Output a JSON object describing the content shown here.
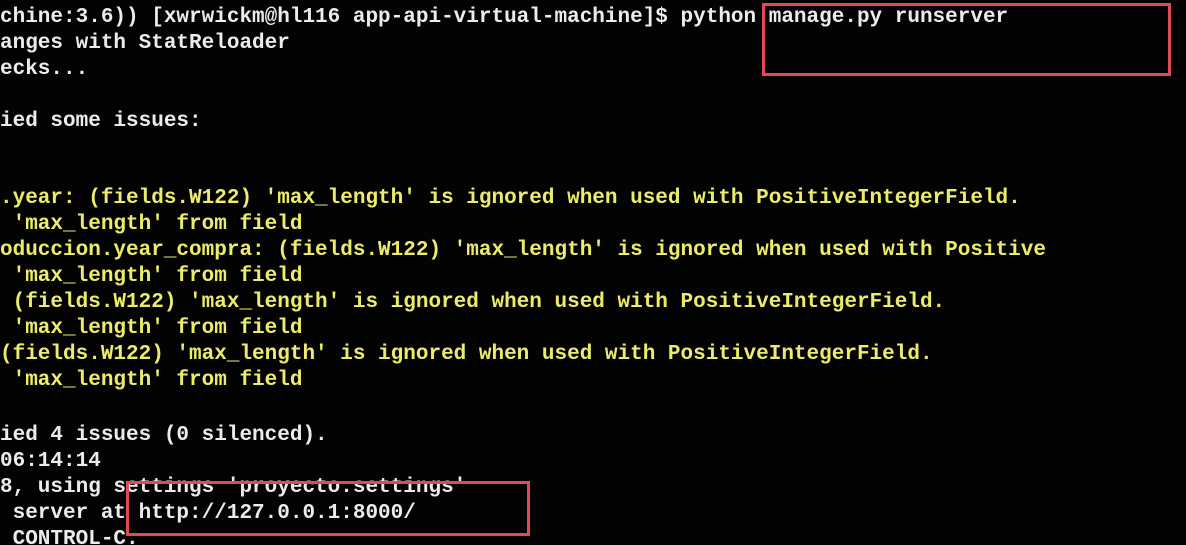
{
  "terminal": {
    "lines": [
      {
        "text": "chine:3.6)) [xwrwickm@hl116 app-api-virtual-machine]$ python manage.py runserver",
        "color": "#ececec"
      },
      {
        "text": "anges with StatReloader",
        "color": "#ececec"
      },
      {
        "text": "ecks...",
        "color": "#ececec"
      },
      {
        "text": "",
        "color": "#ececec"
      },
      {
        "text": "ied some issues:",
        "color": "#ececec"
      },
      {
        "text": "",
        "color": "#ececec"
      },
      {
        "text": "",
        "color": "#ececec"
      },
      {
        "text": ".year: (fields.W122) 'max_length' is ignored when used with PositiveIntegerField.",
        "color": "#ecec6a"
      },
      {
        "text": " 'max_length' from field",
        "color": "#ecec6a"
      },
      {
        "text": "oduccion.year_compra: (fields.W122) 'max_length' is ignored when used with Positive",
        "color": "#ecec6a"
      },
      {
        "text": " 'max_length' from field",
        "color": "#ecec6a"
      },
      {
        "text": " (fields.W122) 'max_length' is ignored when used with PositiveIntegerField.",
        "color": "#ecec6a"
      },
      {
        "text": " 'max_length' from field",
        "color": "#ecec6a"
      },
      {
        "text": "(fields.W122) 'max_length' is ignored when used with PositiveIntegerField.",
        "color": "#ecec6a"
      },
      {
        "text": " 'max_length' from field",
        "color": "#ecec6a"
      },
      {
        "text": "",
        "color": "#ececec"
      },
      {
        "text": "ied 4 issues (0 silenced).",
        "color": "#ececec"
      },
      {
        "text": "06:14:14",
        "color": "#ececec"
      },
      {
        "text": "8, using settings 'proyecto.settings'",
        "color": "#ececec"
      },
      {
        "text": " server at http://127.0.0.1:8000/",
        "color": "#ececec"
      },
      {
        "text": " CONTROL-C.",
        "color": "#ececec"
      }
    ]
  },
  "colors": {
    "background": "#030303",
    "output_text": "#ececec",
    "warning_text": "#ecec6a",
    "highlight_border": "#e04a55"
  }
}
